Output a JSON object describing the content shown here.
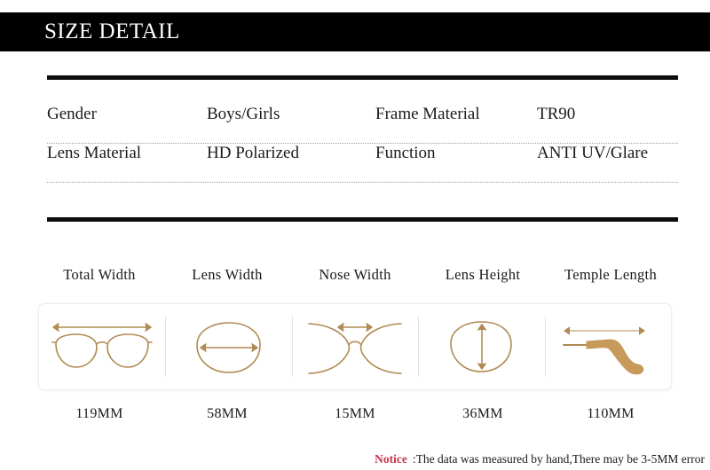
{
  "header": {
    "title": "SIZE DETAIL"
  },
  "colors": {
    "header_background": "#000000",
    "header_text": "#ffffff",
    "rule": "#0d0d0d",
    "diagram_gold": "#b08a52",
    "notice_red": "#c8344a",
    "dotted_separator": "#9a9a9a"
  },
  "spec_table": {
    "rows": [
      {
        "label_1": "Gender",
        "value_1": "Boys/Girls",
        "label_2": "Frame Material",
        "value_2": "TR90"
      },
      {
        "label_1": "Lens Material",
        "value_1": "HD Polarized",
        "label_2": "Function",
        "value_2": "ANTI UV/Glare"
      }
    ]
  },
  "measurements": {
    "items": [
      {
        "label": "Total Width",
        "value": "119MM",
        "icon": "glasses-full-width-icon"
      },
      {
        "label": "Lens Width",
        "value": "58MM",
        "icon": "lens-width-icon"
      },
      {
        "label": "Nose Width",
        "value": "15MM",
        "icon": "nose-bridge-width-icon"
      },
      {
        "label": "Lens Height",
        "value": "36MM",
        "icon": "lens-height-icon"
      },
      {
        "label": "Temple Length",
        "value": "110MM",
        "icon": "temple-length-icon"
      }
    ]
  },
  "notice": {
    "word": "Notice",
    "text": ":The data was measured by hand,There may be 3-5MM error"
  }
}
